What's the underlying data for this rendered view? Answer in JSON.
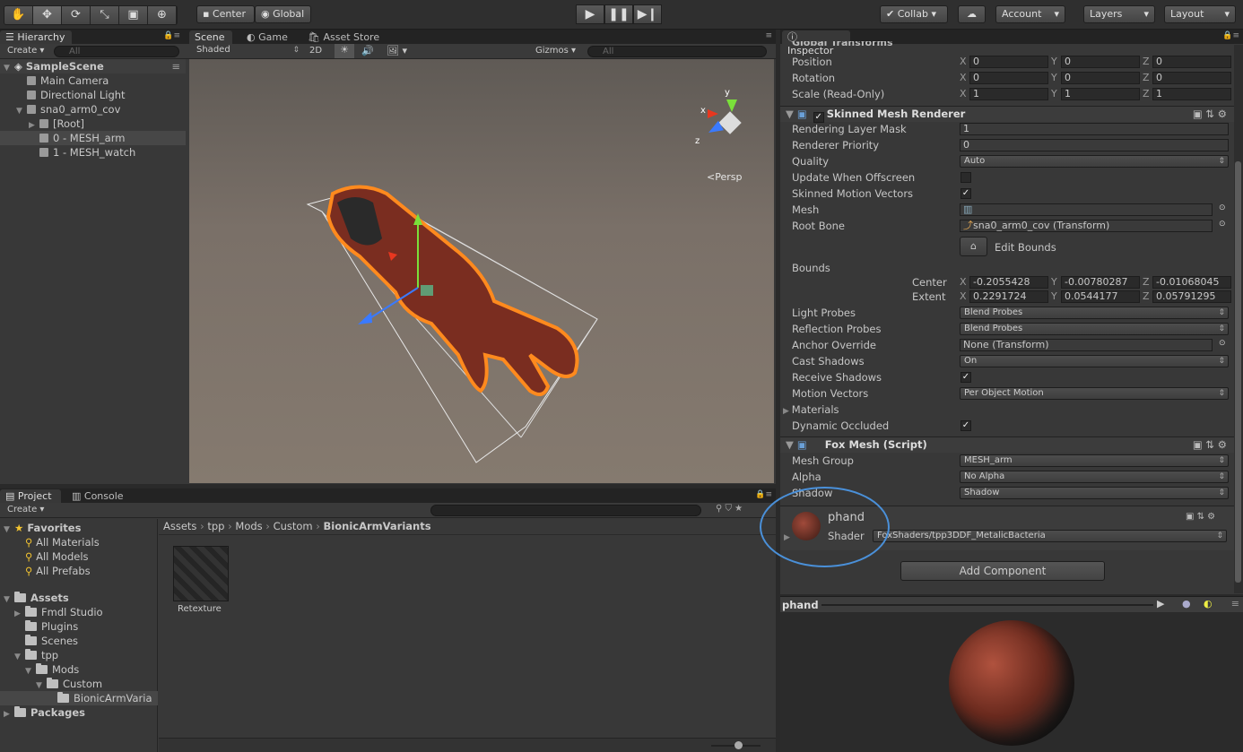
{
  "toolbar": {
    "tools": [
      "✋",
      "✥",
      "⟳",
      "⤡",
      "▣",
      "⊕"
    ],
    "pivot": "Center",
    "space": "Global",
    "collab": "Collab ▾",
    "account": "Account",
    "layers": "Layers",
    "layout": "Layout"
  },
  "hierarchy": {
    "tab": "Hierarchy",
    "create": "Create ▾",
    "search": "All",
    "scene": "SampleScene",
    "items": [
      {
        "label": "Main Camera",
        "depth": 1,
        "arrow": ""
      },
      {
        "label": "Directional Light",
        "depth": 1,
        "arrow": ""
      },
      {
        "label": "sna0_arm0_cov",
        "depth": 1,
        "arrow": "▼"
      },
      {
        "label": "[Root]",
        "depth": 2,
        "arrow": "▶"
      },
      {
        "label": "0 - MESH_arm",
        "depth": 2,
        "arrow": ""
      },
      {
        "label": "1 - MESH_watch",
        "depth": 2,
        "arrow": ""
      }
    ]
  },
  "scene": {
    "tabs": [
      "Scene",
      "Game",
      "Asset Store"
    ],
    "shading": "Shaded",
    "mode2d": "2D",
    "gizmos": "Gizmos",
    "search": "All",
    "persp": "<Persp"
  },
  "project": {
    "tabs": [
      "Project",
      "Console"
    ],
    "create": "Create ▾",
    "favorites": "Favorites",
    "fav_items": [
      "All Materials",
      "All Models",
      "All Prefabs"
    ],
    "assets": "Assets",
    "tree": [
      {
        "label": "Fmdl Studio",
        "depth": 1,
        "arrow": "▶"
      },
      {
        "label": "Plugins",
        "depth": 1,
        "arrow": ""
      },
      {
        "label": "Scenes",
        "depth": 1,
        "arrow": ""
      },
      {
        "label": "tpp",
        "depth": 1,
        "arrow": "▼"
      },
      {
        "label": "Mods",
        "depth": 2,
        "arrow": "▼"
      },
      {
        "label": "Custom",
        "depth": 3,
        "arrow": "▼"
      },
      {
        "label": "BionicArmVaria",
        "depth": 4,
        "arrow": ""
      }
    ],
    "packages": "Packages",
    "breadcrumb": [
      "Assets",
      "tpp",
      "Mods",
      "Custom",
      "BionicArmVariants"
    ],
    "asset_label": "Retexture"
  },
  "inspector": {
    "tab": "Inspector",
    "global_header": "Global Transforms",
    "transform": [
      {
        "label": "Position",
        "x": "0",
        "y": "0",
        "z": "0"
      },
      {
        "label": "Rotation",
        "x": "0",
        "y": "0",
        "z": "0"
      },
      {
        "label": "Scale (Read-Only)",
        "x": "1",
        "y": "1",
        "z": "1"
      }
    ],
    "smr_title": "Skinned Mesh Renderer",
    "rendering_layer_mask": "1",
    "renderer_priority": "0",
    "quality": "Auto",
    "mesh": "",
    "root_bone": "sna0_arm0_cov (Transform)",
    "edit_bounds": "Edit Bounds",
    "labels": {
      "rlm": "Rendering Layer Mask",
      "rp": "Renderer Priority",
      "q": "Quality",
      "uwo": "Update When Offscreen",
      "smv": "Skinned Motion Vectors",
      "mesh": "Mesh",
      "rb": "Root Bone",
      "bounds": "Bounds",
      "center": "Center",
      "extent": "Extent",
      "lp": "Light Probes",
      "rfp": "Reflection Probes",
      "ao": "Anchor Override",
      "cs": "Cast Shadows",
      "rs": "Receive Shadows",
      "mv": "Motion Vectors",
      "mats": "Materials",
      "do": "Dynamic Occluded",
      "mg": "Mesh Group",
      "alpha": "Alpha",
      "shadow": "Shadow",
      "shader": "Shader"
    },
    "center": {
      "x": "-0.2055428",
      "y": "-0.00780287",
      "z": "-0.01068045"
    },
    "extent": {
      "x": "0.2291724",
      "y": "0.0544177",
      "z": "0.05791295"
    },
    "light_probes": "Blend Probes",
    "reflection_probes": "Blend Probes",
    "anchor_override": "None (Transform)",
    "cast_shadows": "On",
    "motion_vectors": "Per Object Motion",
    "fox_title": "Fox Mesh (Script)",
    "mesh_group": "MESH_arm",
    "alpha": "No Alpha",
    "shadow": "Shadow",
    "material_name": "phand",
    "shader": "FoxShaders/tpp3DDF_MetalicBacteria",
    "add_component": "Add Component",
    "preview_name": "phand"
  }
}
